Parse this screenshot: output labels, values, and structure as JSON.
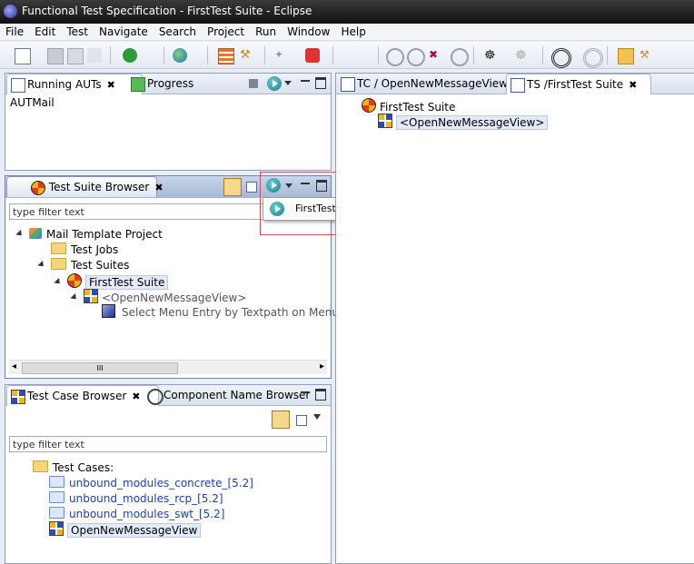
{
  "window": {
    "title": "Functional Test Specification - FirstTest Suite - Eclipse"
  },
  "menu": [
    "File",
    "Edit",
    "Test",
    "Navigate",
    "Search",
    "Project",
    "Run",
    "Window",
    "Help"
  ],
  "running_auts": {
    "tabs": [
      {
        "label": "Running AUTs"
      },
      {
        "label": "Progress"
      }
    ],
    "items": [
      "AUTMail"
    ]
  },
  "test_suite_browser": {
    "tab_label": "Test Suite Browser",
    "filter_placeholder": "type filter text",
    "tree": {
      "project": "Mail Template Project",
      "jobs": "Test Jobs",
      "suites": "Test Suites",
      "suite": "FirstTest Suite",
      "ref": "<OpenNewMessageView>",
      "step": "Select Menu Entry by Textpath on Menu Bar (\"F"
    },
    "scroll_mid": "III"
  },
  "start_menu": {
    "item": "FirstTest Suite : AUT Mail (AUTMail)"
  },
  "test_case_browser": {
    "tabs": [
      {
        "label": "Test Case Browser"
      },
      {
        "label": "Component Name Browser"
      }
    ],
    "filter_placeholder": "type filter text",
    "root": "Test Cases:",
    "items": [
      {
        "label": "unbound_modules_concrete_[5.2]"
      },
      {
        "label": "unbound_modules_rcp_[5.2]"
      },
      {
        "label": "unbound_modules_swt_[5.2]"
      }
    ],
    "selected": "OpenNewMessageView"
  },
  "editors": {
    "tabs": [
      {
        "label": "TC / OpenNewMessageView"
      },
      {
        "label": "TS /FirstTest Suite"
      }
    ],
    "tree_root": "FirstTest Suite",
    "tree_child": "<OpenNewMessageView>"
  },
  "colors": {
    "accent_border": "#d84a57",
    "link_blue": "#1f3fb8"
  }
}
